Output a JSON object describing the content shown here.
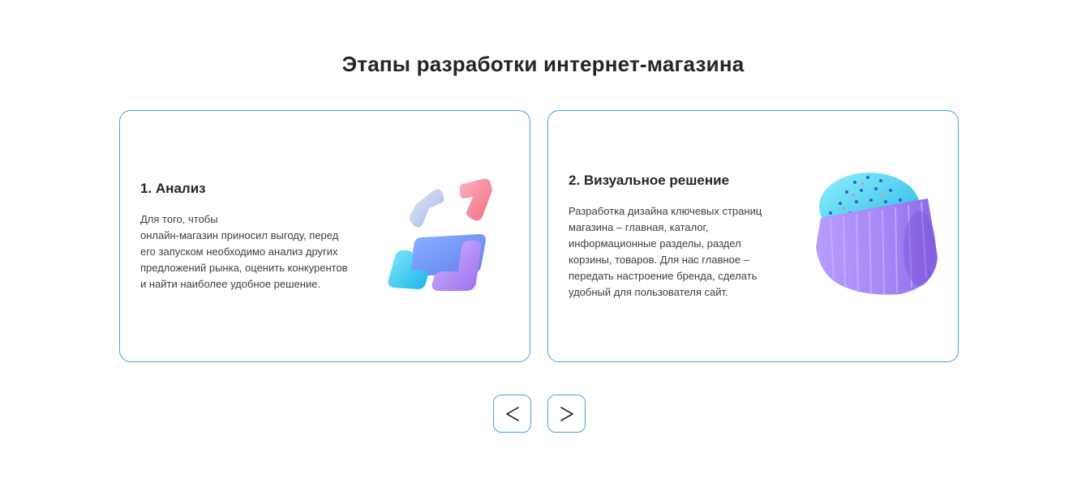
{
  "section": {
    "title": "Этапы разработки интернет-магазина"
  },
  "cards": [
    {
      "title": "1. Анализ",
      "description": "Для того, чтобы\nонлайн-магазин приносил выгоду, перед\nего запуском необходимо анализ других\nпредложений рынка, оценить конкурентов\nи найти наиболее удобное решение.",
      "image": "abstract-3d-shapes-illustration"
    },
    {
      "title": "2. Визуальное решение",
      "description": "Разработка дизайна ключевых страниц\nмагазина – главная, каталог,\nинформационные разделы, раздел\nкорзины, товаров. Для нас главное –\nпередать настроение бренда, сделать\nудобный для пользователя сайт.",
      "image": "3d-cupcake-illustration"
    }
  ],
  "navigation": {
    "prev_icon": "chevron-left-icon",
    "next_icon": "chevron-right-icon"
  },
  "colors": {
    "accent_border": "#3fa3e6",
    "heading": "#22262b",
    "body_text": "#3a3f45"
  }
}
